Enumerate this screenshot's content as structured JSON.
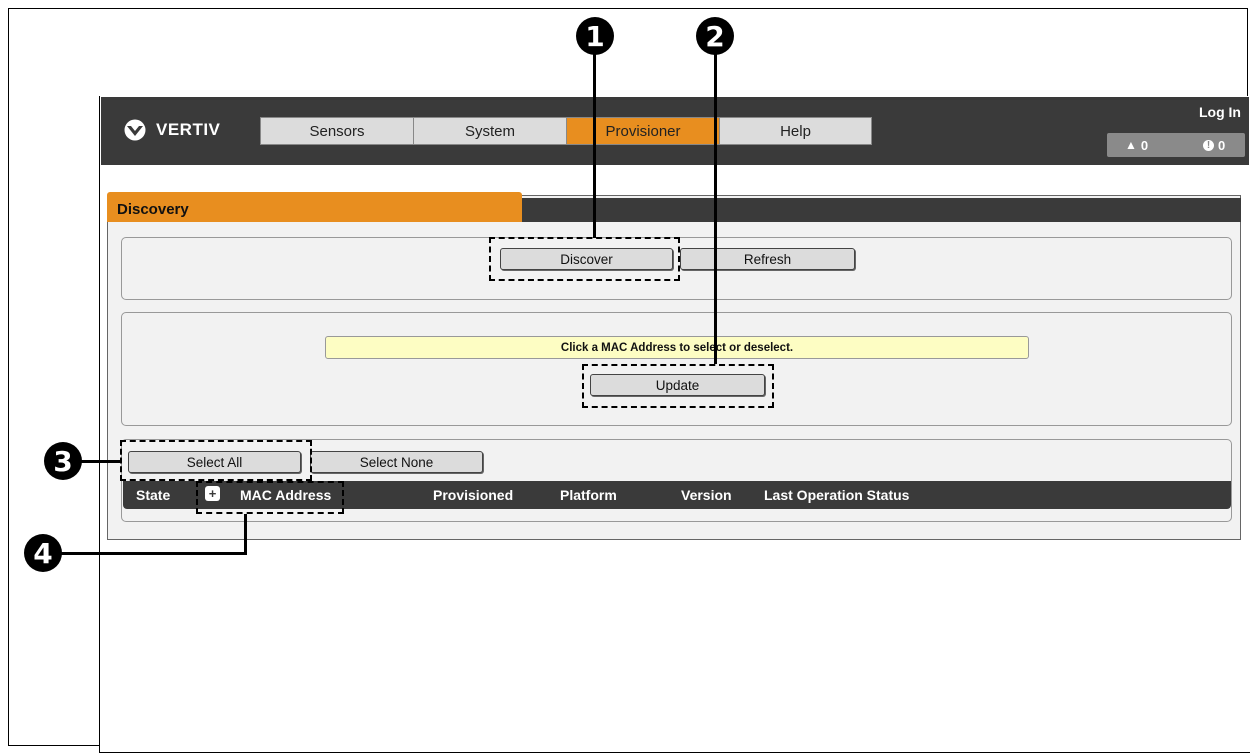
{
  "header": {
    "brand": "VERTIV",
    "login_label": "Log In",
    "alerts": [
      {
        "icon": "warning-icon",
        "glyph": "▲",
        "count": "0"
      },
      {
        "icon": "critical-icon",
        "glyph": "!",
        "count": "0"
      }
    ]
  },
  "nav": {
    "tabs": [
      {
        "label": "Sensors",
        "active": false
      },
      {
        "label": "System",
        "active": false
      },
      {
        "label": "Provisioner",
        "active": true
      },
      {
        "label": "Help",
        "active": false
      }
    ]
  },
  "discovery": {
    "tab_label": "Discovery",
    "discover_label": "Discover",
    "refresh_label": "Refresh",
    "info_message": "Click a MAC Address to select or deselect.",
    "update_label": "Update",
    "select_all_label": "Select All",
    "select_none_label": "Select None",
    "columns": [
      "State",
      "MAC Address",
      "Provisioned",
      "Platform",
      "Version",
      "Last Operation Status"
    ]
  },
  "callouts": [
    "1",
    "2",
    "3",
    "4"
  ],
  "colors": {
    "accent": "#e88e1f",
    "header_bg": "#3a3a3a",
    "info_bg": "#fdfdc3"
  }
}
